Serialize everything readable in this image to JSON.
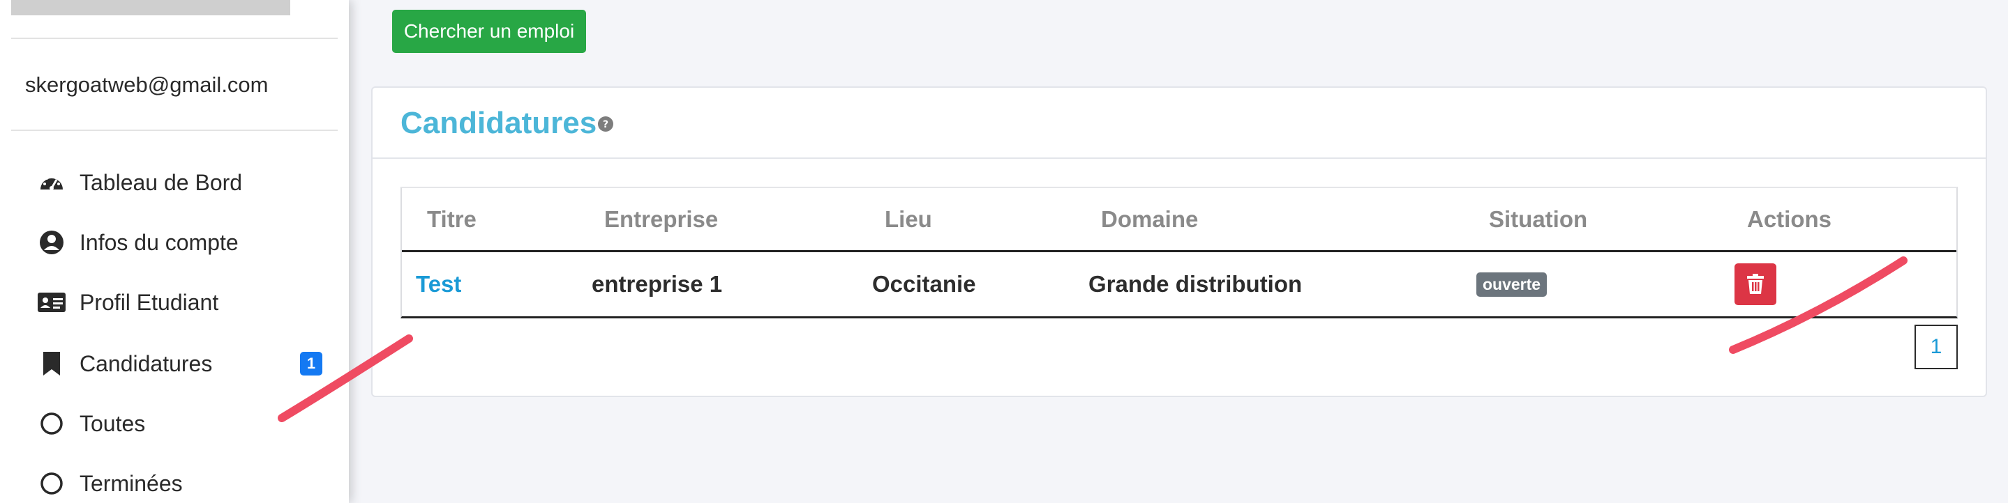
{
  "sidebar": {
    "email": "skergoatweb@gmail.com",
    "items": [
      {
        "label": "Tableau de Bord",
        "icon": "dashboard-gauge-icon"
      },
      {
        "label": "Infos du compte",
        "icon": "user-circle-icon"
      },
      {
        "label": "Profil Etudiant",
        "icon": "id-card-icon"
      },
      {
        "label": "Candidatures",
        "icon": "bookmark-icon",
        "badge": "1"
      },
      {
        "label": "Toutes",
        "icon": "circle-outline-icon"
      },
      {
        "label": "Terminées",
        "icon": "circle-outline-icon"
      }
    ]
  },
  "main": {
    "search_button": "Chercher un emploi",
    "card": {
      "title": "Candidatures",
      "table": {
        "headers": [
          "Titre",
          "Entreprise",
          "Lieu",
          "Domaine",
          "Situation",
          "Actions"
        ],
        "rows": [
          {
            "titre": "Test",
            "entreprise": "entreprise 1",
            "lieu": "Occitanie",
            "domaine": "Grande distribution",
            "situation": "ouverte"
          }
        ]
      },
      "pagination": {
        "current": "1"
      }
    }
  },
  "colors": {
    "accent_title": "#4cb6d8",
    "link": "#1a9ad6",
    "success": "#28a745",
    "danger": "#dc3545",
    "badge_blue": "#1479f2",
    "status_gray": "#6c757d",
    "annotation_stroke": "#ef4b62"
  }
}
